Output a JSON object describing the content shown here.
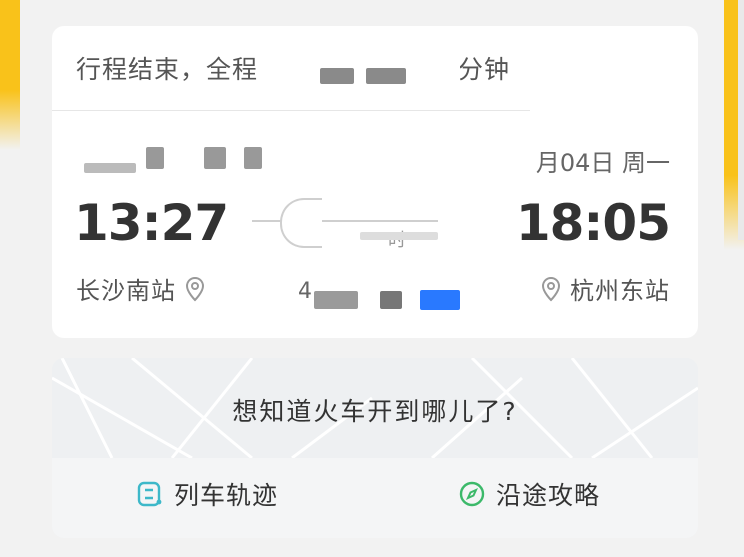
{
  "summary": {
    "prefix": "行程结束，全程",
    "suffix": "分钟"
  },
  "trip": {
    "depart_date": "",
    "arrive_date": "月04日 周一",
    "depart_time": "13:27",
    "arrive_time": "18:05",
    "depart_station": "长沙南站",
    "arrive_station": "杭州东站",
    "duration_label": "时",
    "train_no": "4"
  },
  "map": {
    "question": "想知道火车开到哪儿了?"
  },
  "actions": {
    "track_label": "列车轨迹",
    "guide_label": "沿途攻略"
  },
  "colors": {
    "accent": "#f9c21a",
    "blue": "#2979ff",
    "teal": "#3db8c9",
    "green": "#3cb96a"
  },
  "icons": {
    "depart_pin": "location-pin-icon",
    "arrive_pin": "location-pin-icon",
    "track": "route-track-icon",
    "guide": "compass-icon"
  }
}
